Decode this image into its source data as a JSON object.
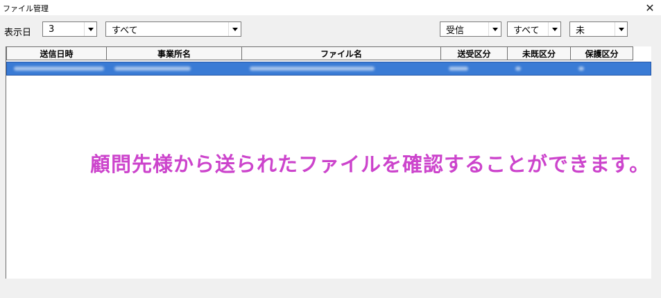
{
  "window": {
    "title": "ファイル管理"
  },
  "filters": {
    "display_days_label": "表示日",
    "display_days_value": "3",
    "office_value": "すべて",
    "direction_value": "受信",
    "read_status_value": "すべて",
    "keep_status_value": "未"
  },
  "table": {
    "headers": [
      "送信日時",
      "事業所名",
      "ファイル名",
      "送受区分",
      "未既区分",
      "保護区分"
    ]
  },
  "annotation": {
    "text": "顧問先様から送られたファイルを確認することができます。"
  },
  "colors": {
    "selection": "#3a7bd5",
    "annotation": "#cc44cc"
  }
}
